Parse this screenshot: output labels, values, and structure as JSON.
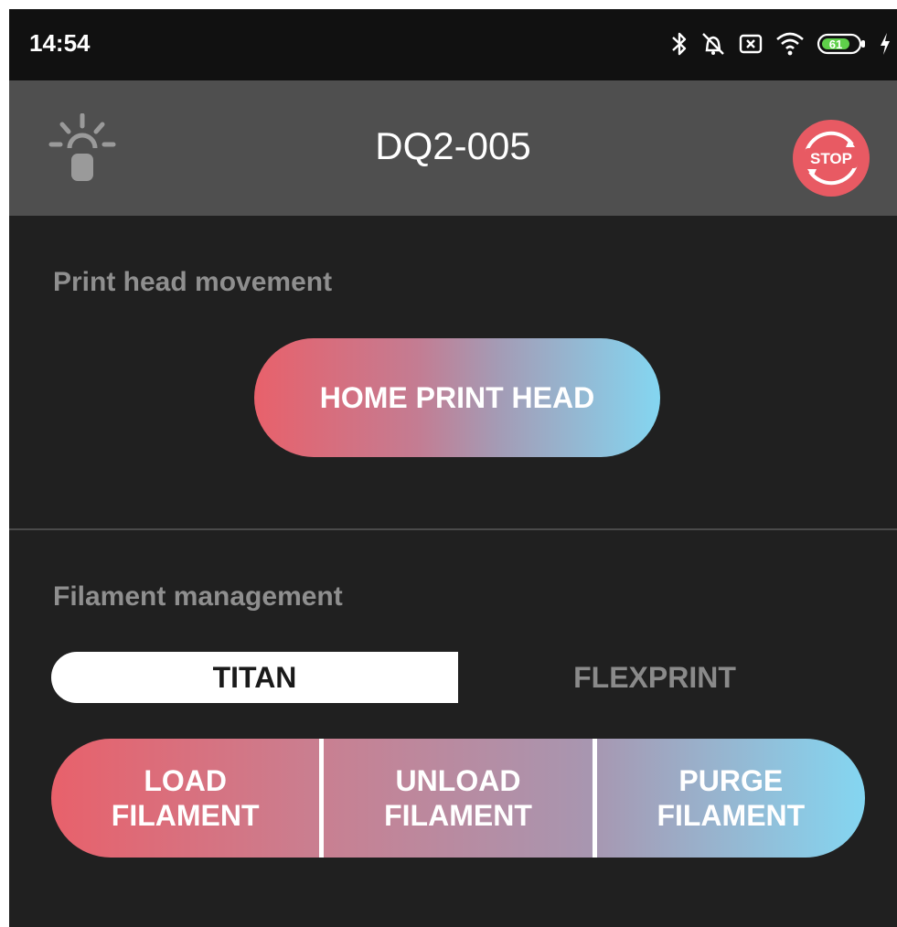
{
  "status_bar": {
    "time": "14:54",
    "battery_level": "61",
    "icons": [
      "bluetooth-icon",
      "alarm-off-icon",
      "sim-x-icon",
      "wifi-icon",
      "battery-icon",
      "charging-icon"
    ]
  },
  "app_bar": {
    "title": "DQ2-005",
    "left_icon": "lightbulb-icon",
    "right_button": {
      "icon": "stop-icon",
      "label": "STOP"
    }
  },
  "print_head": {
    "section_label": "Print head movement",
    "home_button": "HOME PRINT HEAD"
  },
  "filament": {
    "section_label": "Filament management",
    "tabs": [
      {
        "label": "TITAN",
        "selected": true
      },
      {
        "label": "FLEXPRINT",
        "selected": false
      }
    ],
    "buttons": [
      {
        "line1": "LOAD",
        "line2": "FILAMENT"
      },
      {
        "line1": "UNLOAD",
        "line2": "FILAMENT"
      },
      {
        "line1": "PURGE",
        "line2": "FILAMENT"
      }
    ]
  },
  "colors": {
    "gradient_start": "#e8616b",
    "gradient_end": "#84d6f1",
    "background": "#202020",
    "app_bar": "#4f4f4f",
    "label_gray": "#8f8f8f",
    "stop_red": "#e85a63"
  }
}
